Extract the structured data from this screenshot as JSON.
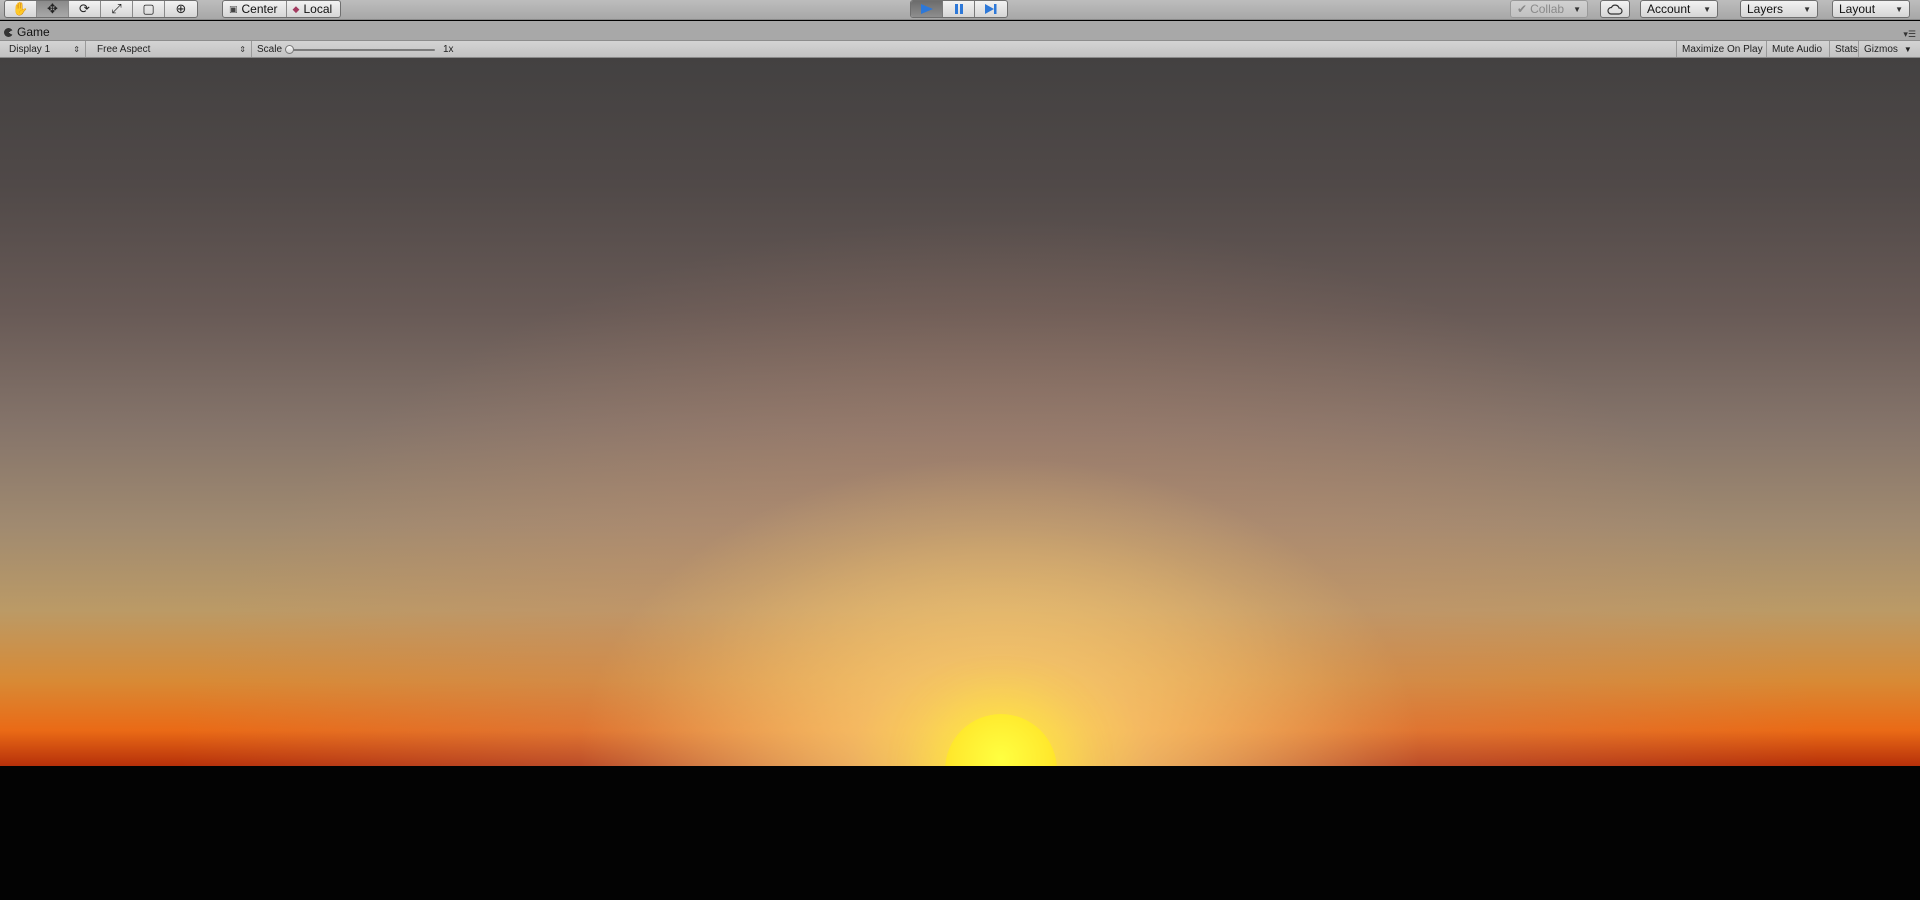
{
  "toolbar": {
    "transform_tools": [
      {
        "name": "hand-tool",
        "glyph": "✋"
      },
      {
        "name": "move-tool",
        "glyph": "✥"
      },
      {
        "name": "rotate-tool",
        "glyph": "⟳"
      },
      {
        "name": "scale-tool",
        "glyph": "⤢"
      },
      {
        "name": "rect-tool",
        "glyph": "▢"
      },
      {
        "name": "transform-tool",
        "glyph": "⊕"
      }
    ],
    "pivot_mode": "Center",
    "pivot_rotation": "Local",
    "collab_label": "Collab",
    "account_label": "Account",
    "layers_label": "Layers",
    "layout_label": "Layout"
  },
  "tab": {
    "title": "Game"
  },
  "game_view": {
    "display": "Display 1",
    "aspect": "Free Aspect",
    "scale_label": "Scale",
    "scale_value": "1x",
    "scale_fraction": 0.0,
    "maximize_label": "Maximize On Play",
    "mute_label": "Mute Audio",
    "stats_label": "Stats",
    "gizmos_label": "Gizmos"
  },
  "colors": {
    "play_blue": "#2d78d8",
    "sun": "#ffe92e",
    "horizon": "#ea6a16",
    "ground": "#030303"
  }
}
